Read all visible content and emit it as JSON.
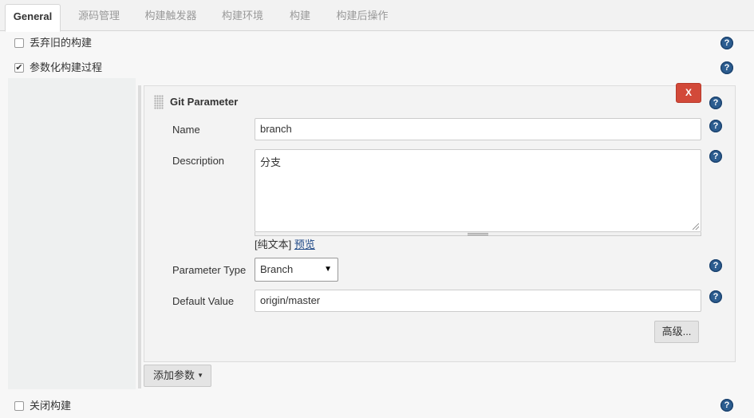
{
  "tabs": [
    {
      "label": "General",
      "active": true
    },
    {
      "label": "源码管理",
      "active": false
    },
    {
      "label": "构建触发器",
      "active": false
    },
    {
      "label": "构建环境",
      "active": false
    },
    {
      "label": "构建",
      "active": false
    },
    {
      "label": "构建后操作",
      "active": false
    }
  ],
  "options": {
    "discard_old_builds": {
      "label": "丢弃旧的构建",
      "checked": false
    },
    "parameterized": {
      "label": "参数化构建过程",
      "checked": true
    },
    "disable_build": {
      "label": "关闭构建",
      "checked": false
    }
  },
  "git_parameter": {
    "title": "Git Parameter",
    "delete_label": "X",
    "name_label": "Name",
    "name_value": "branch",
    "description_label": "Description",
    "description_value": "分支",
    "format_prefix": "[纯文本]",
    "preview_link": "预览",
    "parameter_type_label": "Parameter Type",
    "parameter_type_value": "Branch",
    "default_value_label": "Default Value",
    "default_value": "origin/master",
    "advanced_button": "高级..."
  },
  "add_parameter_button": "添加参数",
  "icons": {
    "help": "help-icon",
    "dropdown": "caret-down-icon",
    "grip": "drag-handle-icon"
  },
  "colors": {
    "help_icon": "#2c5d90",
    "delete_button": "#d24939",
    "link": "#204a87"
  }
}
